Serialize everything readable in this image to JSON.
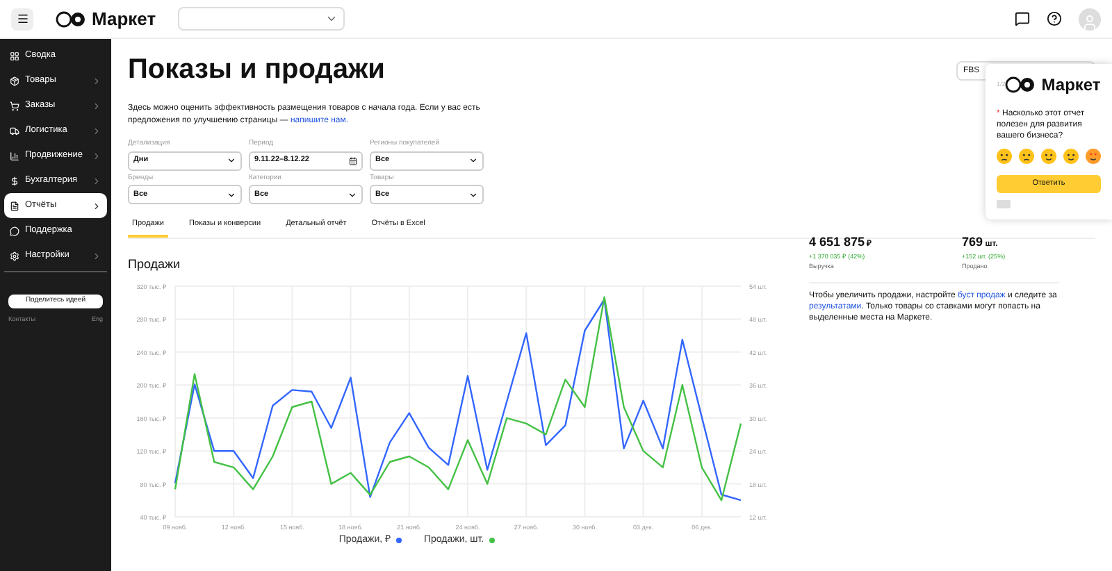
{
  "header": {
    "logo_text": "Маркет"
  },
  "sidebar": {
    "items": [
      {
        "label": "Сводка",
        "has_arrow": false,
        "selected": false
      },
      {
        "label": "Товары",
        "has_arrow": true,
        "selected": false
      },
      {
        "label": "Заказы",
        "has_arrow": true,
        "selected": false
      },
      {
        "label": "Логистика",
        "has_arrow": true,
        "selected": false
      },
      {
        "label": "Продвижение",
        "has_arrow": true,
        "selected": false
      },
      {
        "label": "Бухгалтерия",
        "has_arrow": true,
        "selected": false
      },
      {
        "label": "Отчёты",
        "has_arrow": true,
        "selected": true
      },
      {
        "label": "Поддержка",
        "has_arrow": false,
        "selected": false
      },
      {
        "label": "Настройки",
        "has_arrow": true,
        "selected": false
      }
    ],
    "share_button": "Поделитесь идеей",
    "contacts": "Контакты",
    "language": "Eng"
  },
  "page": {
    "title": "Показы и продажи",
    "description": "Здесь можно оценить эффективность размещения товаров с начала года. Если у вас есть предложения по улучшению страницы — ",
    "description_link": "напишите нам.",
    "model_field": {
      "value": "FBS"
    }
  },
  "filters": [
    {
      "label": "Детализация",
      "value": "Дни",
      "kind": "select"
    },
    {
      "label": "Период",
      "value": "9.11.22–8.12.22",
      "kind": "date"
    },
    {
      "label": "Регионы покупателей",
      "value": "Все",
      "kind": "select"
    },
    {
      "label": "Бренды",
      "value": "Все",
      "kind": "select"
    },
    {
      "label": "Категории",
      "value": "Все",
      "kind": "select"
    },
    {
      "label": "Товары",
      "value": "Все",
      "kind": "select"
    }
  ],
  "tabs": [
    {
      "label": "Продажи",
      "selected": true
    },
    {
      "label": "Показы и конверсии",
      "selected": false
    },
    {
      "label": "Детальный отчёт",
      "selected": false
    },
    {
      "label": "Отчёты в Excel",
      "selected": false
    }
  ],
  "sales": {
    "title": "Продажи",
    "chart_data": {
      "type": "line",
      "grid": true,
      "legend": "bottom",
      "categories": [
        "09 нояб.",
        null,
        null,
        "12 нояб.",
        null,
        null,
        "15 нояб.",
        null,
        null,
        "18 нояб.",
        null,
        null,
        "21 нояб.",
        null,
        null,
        "24 нояб.",
        null,
        null,
        "27 нояб.",
        null,
        null,
        "30 нояб.",
        null,
        null,
        "03 дек.",
        null,
        null,
        "06 дек.",
        null,
        null
      ],
      "ylim": [
        40,
        320
      ],
      "yticks": [
        {
          "value": 40,
          "label": "40 тыс. ₽"
        },
        {
          "value": 80,
          "label": "80 тыс. ₽"
        },
        {
          "value": 120,
          "label": "120 тыс. ₽"
        },
        {
          "value": 160,
          "label": "160 тыс. ₽"
        },
        {
          "value": 200,
          "label": "200 тыс. ₽"
        },
        {
          "value": 240,
          "label": "240 тыс. ₽"
        },
        {
          "value": 280,
          "label": "280 тыс. ₽"
        },
        {
          "value": 320,
          "label": "320 тыс. ₽"
        }
      ],
      "y2lim": [
        12,
        54
      ],
      "y2ticks": [
        {
          "value": 12,
          "label": "12 шт."
        },
        {
          "value": 18,
          "label": "18 шт."
        },
        {
          "value": 24,
          "label": "24 шт."
        },
        {
          "value": 30,
          "label": "30 шт."
        },
        {
          "value": 36,
          "label": "36 шт."
        },
        {
          "value": 42,
          "label": "42 шт."
        },
        {
          "value": 48,
          "label": "48 шт."
        },
        {
          "value": 54,
          "label": "54 шт."
        }
      ],
      "series": [
        {
          "name": "Продажи, ₽",
          "color": "#3366ff",
          "values": [
            81,
            201,
            120,
            120,
            87,
            175,
            194,
            192,
            148,
            209,
            64,
            130,
            166,
            124,
            103,
            211,
            97,
            180,
            263,
            127,
            151,
            266,
            304,
            123,
            181,
            123,
            255,
            161,
            67,
            60
          ]
        },
        {
          "name": "Продажи, шт.",
          "color": "#45c145",
          "axis": "y2",
          "values": [
            17,
            38,
            22,
            21,
            17,
            23,
            32,
            33,
            18,
            20,
            16,
            22,
            23,
            21,
            17,
            26,
            18,
            30,
            29,
            27,
            37,
            32,
            52,
            32,
            24,
            21,
            36,
            21,
            15,
            29
          ]
        }
      ]
    },
    "stats": [
      {
        "value": "4 651 875",
        "unit": "₽",
        "change": "+1 370 035 ₽ (42%)",
        "label": "Выручка"
      },
      {
        "value": "769",
        "unit": "шт.",
        "change": "+152 шт. (25%)",
        "label": "Продано"
      }
    ],
    "tip": {
      "text_1": "Чтобы увеличить продажи, настройте ",
      "link_1": "буст продаж",
      "text_2": " и следите за ",
      "link_2": "результатами",
      "text_3": ". Только товары со ставками могут попасть на выделенные места на Маркете."
    }
  },
  "survey": {
    "counter": "1/2",
    "logo_text": "Маркет",
    "required_mark": "*",
    "question": "Насколько этот отчет полезен для развития вашего бизнеса?",
    "submit": "Ответить"
  }
}
